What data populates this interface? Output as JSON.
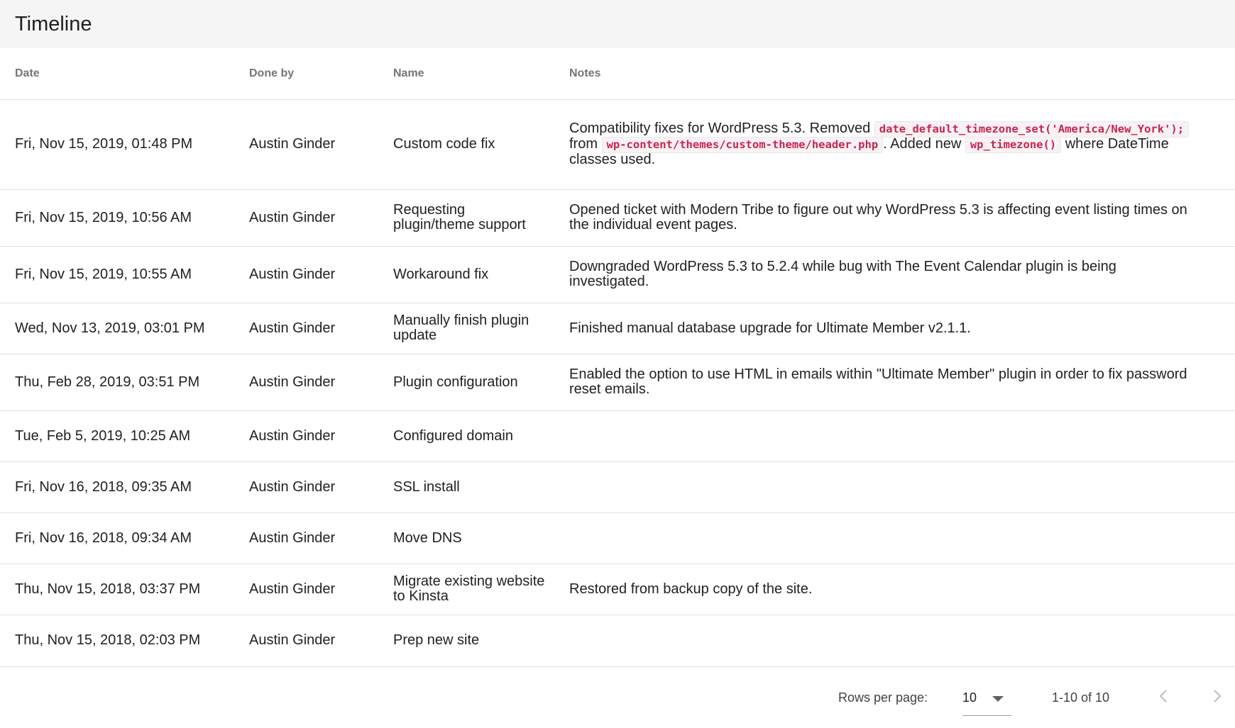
{
  "header": {
    "title": "Timeline"
  },
  "columns": {
    "date": "Date",
    "done_by": "Done by",
    "name": "Name",
    "notes": "Notes"
  },
  "rows": [
    {
      "date": "Fri, Nov 15, 2019, 01:48 PM",
      "done_by": "Austin Ginder",
      "name": "Custom code fix",
      "notes": {
        "t1": "Compatibility fixes for WordPress 5.3. Removed ",
        "c1": "date_default_timezone_set('America/New_York');",
        "t2": " from ",
        "c2": "wp-content/themes/custom-theme/header.php",
        "t3": ". Added new ",
        "c3": "wp_timezone()",
        "t4": " where DateTime classes used."
      }
    },
    {
      "date": "Fri, Nov 15, 2019, 10:56 AM",
      "done_by": "Austin Ginder",
      "name": "Requesting plugin/theme support",
      "notes": "Opened ticket with Modern Tribe to figure out why WordPress 5.3 is affecting event listing times on the individual event pages."
    },
    {
      "date": "Fri, Nov 15, 2019, 10:55 AM",
      "done_by": "Austin Ginder",
      "name": "Workaround fix",
      "notes": "Downgraded WordPress 5.3 to 5.2.4 while bug with The Event Calendar plugin is being investigated."
    },
    {
      "date": "Wed, Nov 13, 2019, 03:01 PM",
      "done_by": "Austin Ginder",
      "name": "Manually finish plugin update",
      "notes": "Finished manual database upgrade for Ultimate Member v2.1.1."
    },
    {
      "date": "Thu, Feb 28, 2019, 03:51 PM",
      "done_by": "Austin Ginder",
      "name": "Plugin configuration",
      "notes": "Enabled the option to use HTML in emails within \"Ultimate Member\" plugin in order to fix password reset emails."
    },
    {
      "date": "Tue, Feb 5, 2019, 10:25 AM",
      "done_by": "Austin Ginder",
      "name": "Configured domain",
      "notes": ""
    },
    {
      "date": "Fri, Nov 16, 2018, 09:35 AM",
      "done_by": "Austin Ginder",
      "name": "SSL install",
      "notes": ""
    },
    {
      "date": "Fri, Nov 16, 2018, 09:34 AM",
      "done_by": "Austin Ginder",
      "name": "Move DNS",
      "notes": ""
    },
    {
      "date": "Thu, Nov 15, 2018, 03:37 PM",
      "done_by": "Austin Ginder",
      "name": "Migrate existing website to Kinsta",
      "notes": "Restored from backup copy of the site."
    },
    {
      "date": "Thu, Nov 15, 2018, 02:03 PM",
      "done_by": "Austin Ginder",
      "name": "Prep new site",
      "notes": ""
    }
  ],
  "pagination": {
    "rows_per_page_label": "Rows per page:",
    "rows_per_page_value": "10",
    "range_label": "1-10 of 10",
    "prev_icon": "chevron-left-icon",
    "next_icon": "chevron-right-icon"
  }
}
